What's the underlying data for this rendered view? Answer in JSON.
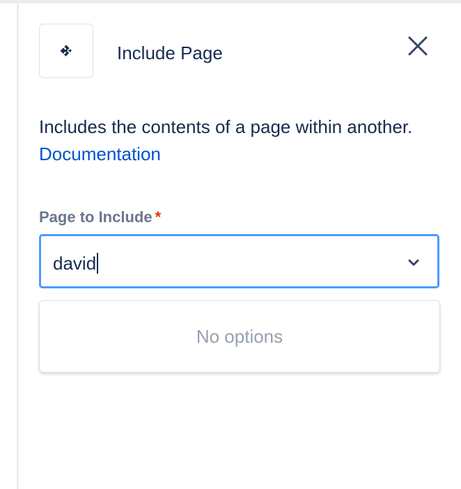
{
  "panel": {
    "title": "Include Page",
    "icon": "puzzle-icon",
    "close_icon": "close-icon"
  },
  "description": {
    "text": "Includes the contents of a page within another. ",
    "link_label": "Documentation"
  },
  "field": {
    "label": "Page to Include",
    "required_marker": "*",
    "value": "david",
    "chevron_icon": "chevron-down-icon"
  },
  "dropdown": {
    "empty_message": "No options"
  },
  "colors": {
    "text": "#172b4d",
    "link": "#0052cc",
    "label": "#6b778c",
    "required": "#de350b",
    "focus_border": "#4c9aff",
    "muted": "#97a0af"
  }
}
